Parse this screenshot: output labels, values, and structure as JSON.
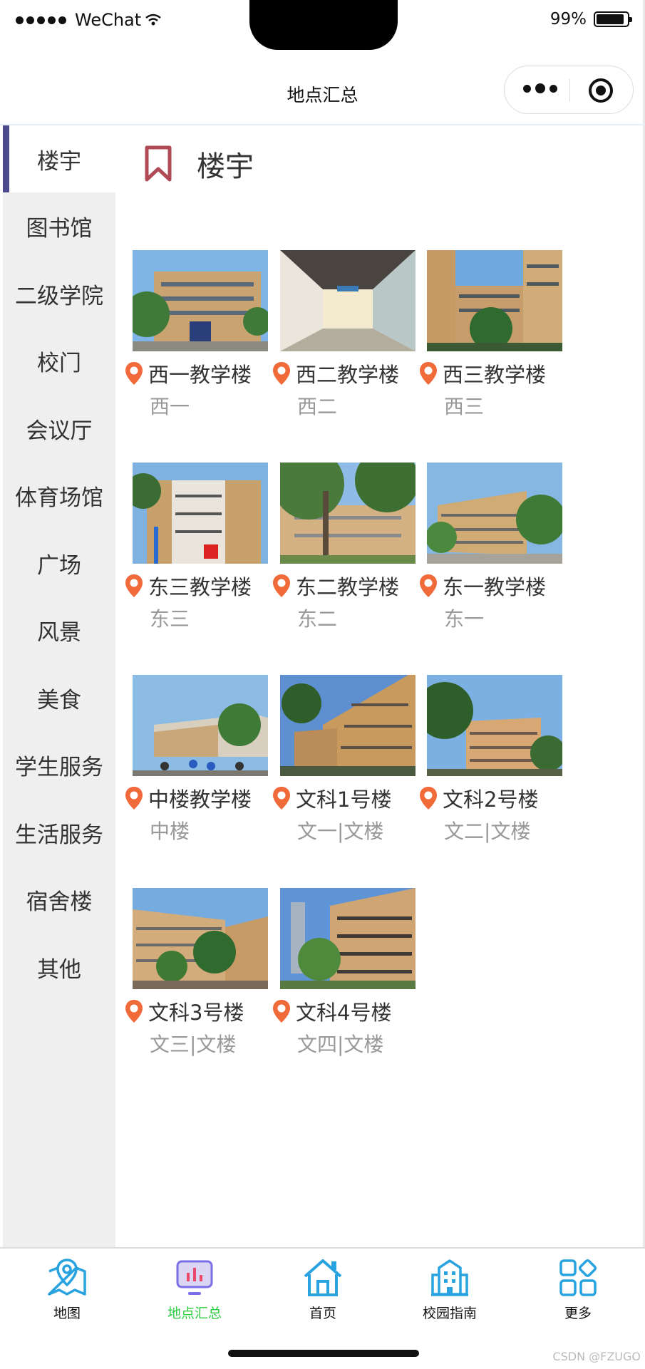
{
  "status_bar": {
    "carrier": "WeChat",
    "battery": "99%"
  },
  "navbar": {
    "title": "地点汇总"
  },
  "sidebar": {
    "items": [
      {
        "label": "楼宇",
        "active": true
      },
      {
        "label": "图书馆"
      },
      {
        "label": "二级学院"
      },
      {
        "label": "校门"
      },
      {
        "label": "会议厅"
      },
      {
        "label": "体育场馆"
      },
      {
        "label": "广场"
      },
      {
        "label": "风景"
      },
      {
        "label": "美食"
      },
      {
        "label": "学生服务"
      },
      {
        "label": "生活服务"
      },
      {
        "label": "宿舍楼"
      },
      {
        "label": "其他"
      }
    ]
  },
  "section": {
    "title": "楼宇"
  },
  "places": [
    {
      "name": "西一教学楼",
      "alias": "西一"
    },
    {
      "name": "西二教学楼",
      "alias": "西二"
    },
    {
      "name": "西三教学楼",
      "alias": "西三"
    },
    {
      "name": "东三教学楼",
      "alias": "东三"
    },
    {
      "name": "东二教学楼",
      "alias": "东二"
    },
    {
      "name": "东一教学楼",
      "alias": "东一"
    },
    {
      "name": "中楼教学楼",
      "alias": "中楼"
    },
    {
      "name": "文科1号楼",
      "alias": "文一|文楼"
    },
    {
      "name": "文科2号楼",
      "alias": "文二|文楼"
    },
    {
      "name": "文科3号楼",
      "alias": "文三|文楼"
    },
    {
      "name": "文科4号楼",
      "alias": "文四|文楼"
    }
  ],
  "tabbar": {
    "tabs": [
      {
        "label": "地图",
        "icon": "map-pin-icon"
      },
      {
        "label": "地点汇总",
        "icon": "chart-icon",
        "active": true
      },
      {
        "label": "首页",
        "icon": "home-icon"
      },
      {
        "label": "校园指南",
        "icon": "building-icon"
      },
      {
        "label": "更多",
        "icon": "grid-icon"
      }
    ]
  },
  "watermark": "CSDN @FZUGO",
  "colors": {
    "pin": "#f06a3a",
    "bookmark": "#b04b56",
    "tab_icon": "#29a3e0",
    "tab_active_text": "#2ecc40",
    "sidebar_accent": "#4a4a8c"
  }
}
